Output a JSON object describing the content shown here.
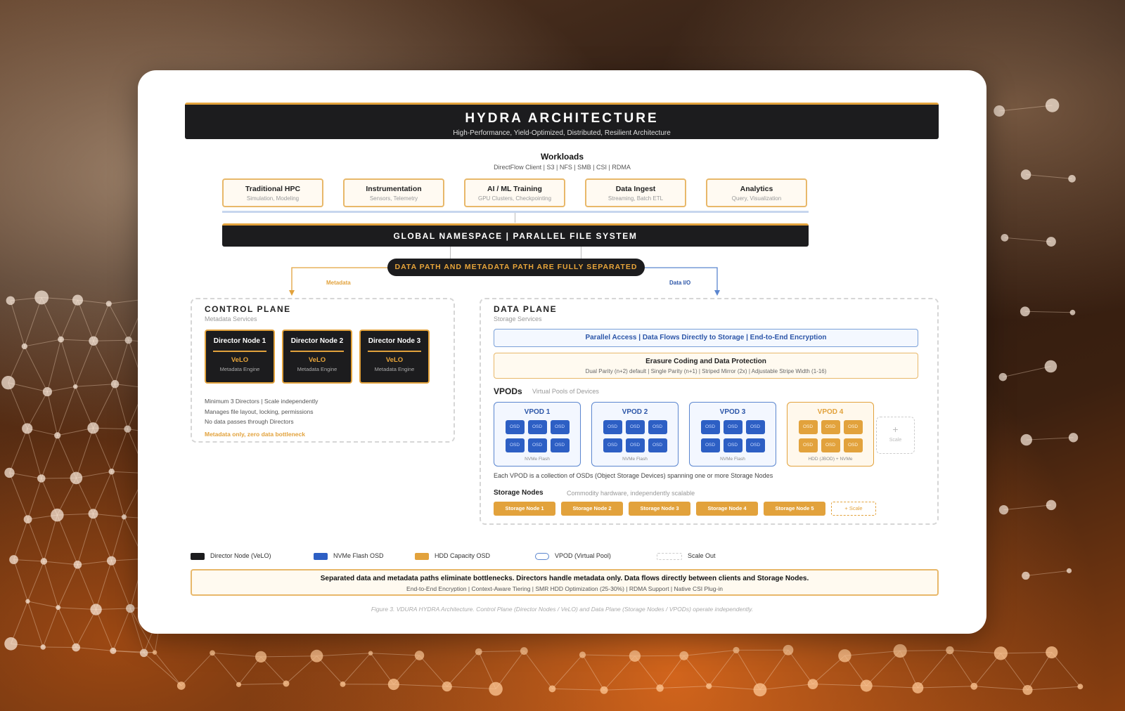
{
  "header": {
    "title": "HYDRA ARCHITECTURE",
    "subtitle": "High-Performance, Yield-Optimized, Distributed, Resilient Architecture"
  },
  "workloads": {
    "title": "Workloads",
    "protocols": "DirectFlow Client | S3 | NFS | SMB | CSI | RDMA",
    "items": [
      {
        "name": "Traditional HPC",
        "desc": "Simulation, Modeling"
      },
      {
        "name": "Instrumentation",
        "desc": "Sensors, Telemetry"
      },
      {
        "name": "AI / ML Training",
        "desc": "GPU Clusters, Checkpointing"
      },
      {
        "name": "Data Ingest",
        "desc": "Streaming, Batch ETL"
      },
      {
        "name": "Analytics",
        "desc": "Query, Visualization"
      }
    ]
  },
  "namespace": "GLOBAL NAMESPACE | PARALLEL FILE SYSTEM",
  "separation": "DATA PATH AND METADATA PATH ARE FULLY SEPARATED",
  "arrows": {
    "metadata": "Metadata",
    "data_io": "Data I/O"
  },
  "control_plane": {
    "title": "CONTROL PLANE",
    "subtitle": "Metadata Services",
    "directors": [
      {
        "name": "Director Node 1",
        "velo": "VeLO",
        "engine": "Metadata Engine"
      },
      {
        "name": "Director Node 2",
        "velo": "VeLO",
        "engine": "Metadata Engine"
      },
      {
        "name": "Director Node 3",
        "velo": "VeLO",
        "engine": "Metadata Engine"
      }
    ],
    "notes": [
      "Minimum 3 Directors | Scale independently",
      "Manages file layout, locking, permissions",
      "No data passes through Directors"
    ],
    "accent_note": "Metadata only, zero data bottleneck"
  },
  "data_plane": {
    "title": "DATA PLANE",
    "subtitle": "Storage Services",
    "parallel_access": "Parallel Access | Data Flows Directly to Storage | End-to-End Encryption",
    "erasure": {
      "title": "Erasure Coding and Data Protection",
      "desc": "Dual Parity (n+2) default | Single Parity (n+1) | Striped Mirror (2x) | Adjustable Stripe Width (1-16)"
    },
    "vpods_title": "VPODs",
    "vpods_subtitle": "Virtual Pools of Devices",
    "vpods": [
      {
        "name": "VPOD 1",
        "osd": [
          "OSD",
          "OSD",
          "OSD",
          "OSD",
          "OSD",
          "OSD"
        ],
        "footer": "NVMe Flash"
      },
      {
        "name": "VPOD 2",
        "osd": [
          "OSD",
          "OSD",
          "OSD",
          "OSD",
          "OSD",
          "OSD"
        ],
        "footer": "NVMe Flash"
      },
      {
        "name": "VPOD 3",
        "osd": [
          "OSD",
          "OSD",
          "OSD",
          "OSD",
          "OSD",
          "OSD"
        ],
        "footer": "NVMe Flash"
      },
      {
        "name": "VPOD 4",
        "osd": [
          "OSD",
          "OSD",
          "OSD",
          "OSD",
          "OSD",
          "OSD"
        ],
        "footer": "HDD (JBOD) + NVMe"
      }
    ],
    "vpod_scale": {
      "symbol": "+",
      "label": "Scale"
    },
    "vpod_note": "Each VPOD is a collection of OSDs (Object Storage Devices) spanning one or more Storage Nodes",
    "storage_nodes_title": "Storage Nodes",
    "storage_nodes_subtitle": "Commodity hardware, independently scalable",
    "storage_nodes": [
      "Storage Node 1",
      "Storage Node 2",
      "Storage Node 3",
      "Storage Node 4",
      "Storage Node 5"
    ],
    "storage_scale": "+ Scale"
  },
  "legend": [
    {
      "label": "Director Node (VeLO)",
      "color": "#1c1c1e"
    },
    {
      "label": "NVMe Flash OSD",
      "color": "#2d5fc4"
    },
    {
      "label": "HDD Capacity OSD",
      "color": "#e2a23c"
    },
    {
      "label": "VPOD (Virtual Pool)",
      "color": "#5b86cf"
    },
    {
      "label": "Scale Out",
      "color": "#cccccc"
    }
  ],
  "summary": {
    "main": "Separated data and metadata paths eliminate bottlenecks. Directors handle metadata only. Data flows directly between clients and Storage Nodes.",
    "features": "End-to-End Encryption | Context-Aware Tiering | SMR HDD Optimization (25-30%) | RDMA Support | Native CSI Plug-in"
  },
  "caption": "Figure 3. VDURA HYDRA Architecture. Control Plane (Director Nodes / VeLO) and Data Plane (Storage Nodes / VPODs) operate independently."
}
